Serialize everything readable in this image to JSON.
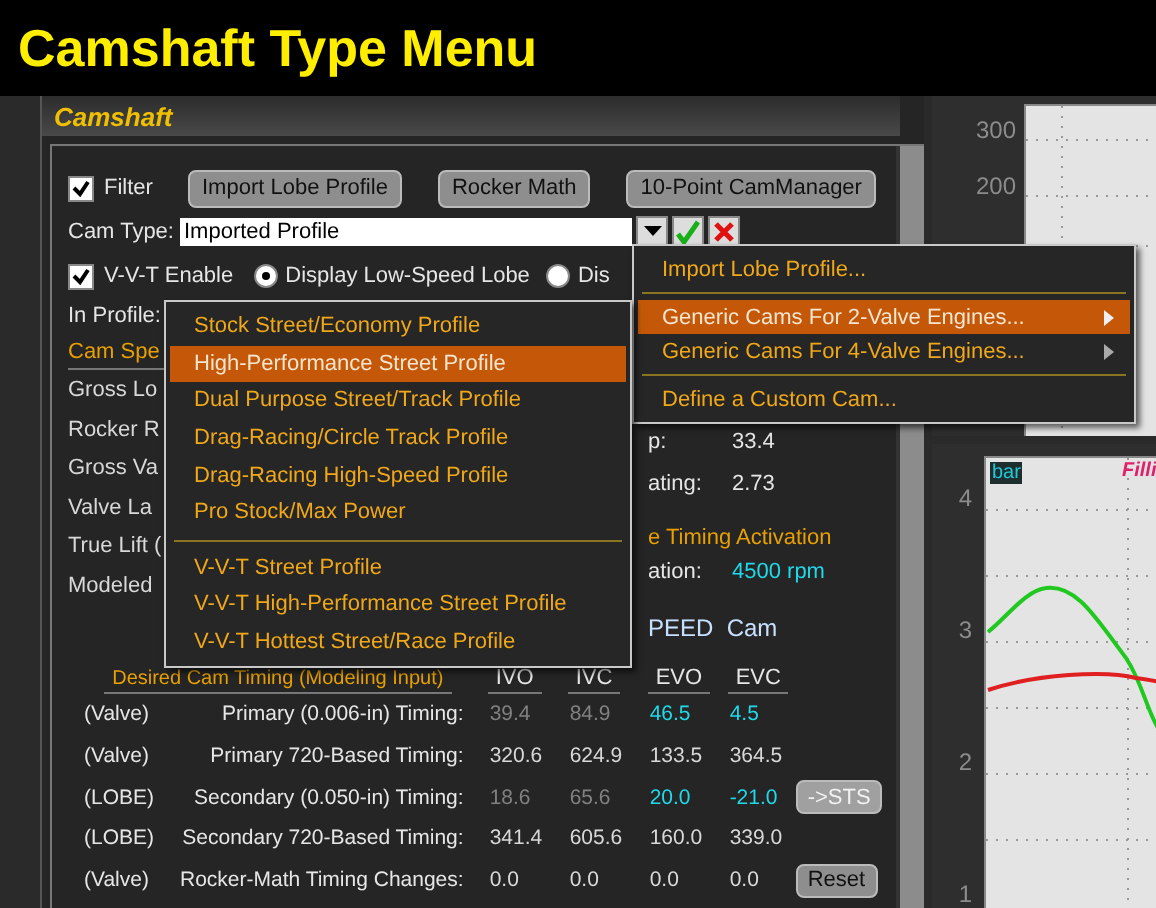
{
  "title": "Camshaft Type Menu",
  "panel": {
    "title": "Camshaft",
    "filter": {
      "label": "Filter",
      "checked": true
    },
    "buttons": [
      "Import Lobe Profile",
      "Rocker Math",
      "10-Point CamManager"
    ],
    "cam_type": {
      "label": "Cam Type:",
      "value": "Imported Profile"
    },
    "vvt": {
      "label": "V-V-T Enable",
      "checked": true
    },
    "lobe_options": [
      {
        "label": "Display Low-Speed Lobe",
        "selected": true
      },
      {
        "label": "Dis",
        "selected": false
      }
    ],
    "in_profile_label": "In Profile:",
    "cam_spec_heading": "Cam Spe",
    "spec_labels": [
      "Gross Lo",
      "Rocker R",
      "Gross Va",
      "Valve La",
      "True Lift (",
      "Modeled"
    ],
    "spec_fields": [
      {
        "label": "p:",
        "value": "33.4"
      },
      {
        "label": "ating:",
        "value": "2.73"
      }
    ],
    "activation_heading": "e Timing Activation",
    "activation": {
      "label": "ation:",
      "value": "4500 rpm"
    },
    "speed_label": "PEED  Cam",
    "timing": {
      "heading": "Desired Cam Timing (Modeling Input)",
      "columns": [
        "IVO",
        "IVC",
        "EVO",
        "EVC"
      ],
      "rows": [
        {
          "prefix": "(Valve)",
          "label": "Primary (0.006-in) Timing:",
          "values": [
            {
              "text": "39.4",
              "kind": "dim"
            },
            {
              "text": "84.9",
              "kind": "dim"
            },
            {
              "text": "46.5",
              "kind": "cyan"
            },
            {
              "text": "4.5",
              "kind": "cyan"
            }
          ]
        },
        {
          "prefix": "(Valve)",
          "label": "Primary 720-Based Timing:",
          "values": [
            {
              "text": "320.6",
              "kind": "normal"
            },
            {
              "text": "624.9",
              "kind": "normal"
            },
            {
              "text": "133.5",
              "kind": "normal"
            },
            {
              "text": "364.5",
              "kind": "normal"
            }
          ]
        },
        {
          "prefix": "(LOBE)",
          "label": "Secondary (0.050-in) Timing:",
          "values": [
            {
              "text": "18.6",
              "kind": "dim"
            },
            {
              "text": "65.6",
              "kind": "dim"
            },
            {
              "text": "20.0",
              "kind": "cyan"
            },
            {
              "text": "-21.0",
              "kind": "cyan"
            }
          ],
          "button": {
            "label": "->STS",
            "disabled": true
          }
        },
        {
          "prefix": "(LOBE)",
          "label": "Secondary 720-Based Timing:",
          "values": [
            {
              "text": "341.4",
              "kind": "normal"
            },
            {
              "text": "605.6",
              "kind": "normal"
            },
            {
              "text": "160.0",
              "kind": "normal"
            },
            {
              "text": "339.0",
              "kind": "normal"
            }
          ]
        },
        {
          "prefix": "(Valve)",
          "label": "Rocker-Math Timing Changes:",
          "values": [
            {
              "text": "0.0",
              "kind": "normal"
            },
            {
              "text": "0.0",
              "kind": "normal"
            },
            {
              "text": "0.0",
              "kind": "normal"
            },
            {
              "text": "0.0",
              "kind": "normal"
            }
          ],
          "button": {
            "label": "Reset",
            "disabled": false
          }
        }
      ]
    }
  },
  "menu": [
    {
      "kind": "item",
      "label": "Import Lobe Profile...",
      "selected": false,
      "submenu": false
    },
    {
      "kind": "separator"
    },
    {
      "kind": "item",
      "label": "Generic Cams For 2-Valve Engines...",
      "selected": true,
      "submenu": true
    },
    {
      "kind": "item",
      "label": "Generic Cams For 4-Valve Engines...",
      "selected": false,
      "submenu": true
    },
    {
      "kind": "separator"
    },
    {
      "kind": "item",
      "label": "Define a Custom Cam...",
      "selected": false,
      "submenu": false
    }
  ],
  "submenu": [
    {
      "kind": "item",
      "label": "Stock Street/Economy Profile",
      "selected": false
    },
    {
      "kind": "item",
      "label": "High-Performance Street Profile",
      "selected": true
    },
    {
      "kind": "item",
      "label": "Dual Purpose Street/Track Profile",
      "selected": false
    },
    {
      "kind": "item",
      "label": "Drag-Racing/Circle Track Profile",
      "selected": false
    },
    {
      "kind": "item",
      "label": "Drag-Racing High-Speed Profile",
      "selected": false
    },
    {
      "kind": "item",
      "label": "Pro Stock/Max Power",
      "selected": false
    },
    {
      "kind": "separator"
    },
    {
      "kind": "item",
      "label": "V-V-T Street Profile",
      "selected": false
    },
    {
      "kind": "item",
      "label": "V-V-T High-Performance Street Profile",
      "selected": false
    },
    {
      "kind": "item",
      "label": "V-V-T Hottest Street/Race Profile",
      "selected": false
    }
  ],
  "charts": [
    {
      "yticks": [
        "300",
        "200"
      ]
    },
    {
      "legend": "bar",
      "title": "Filli",
      "yticks": [
        "4",
        "3",
        "2",
        "1"
      ]
    }
  ]
}
